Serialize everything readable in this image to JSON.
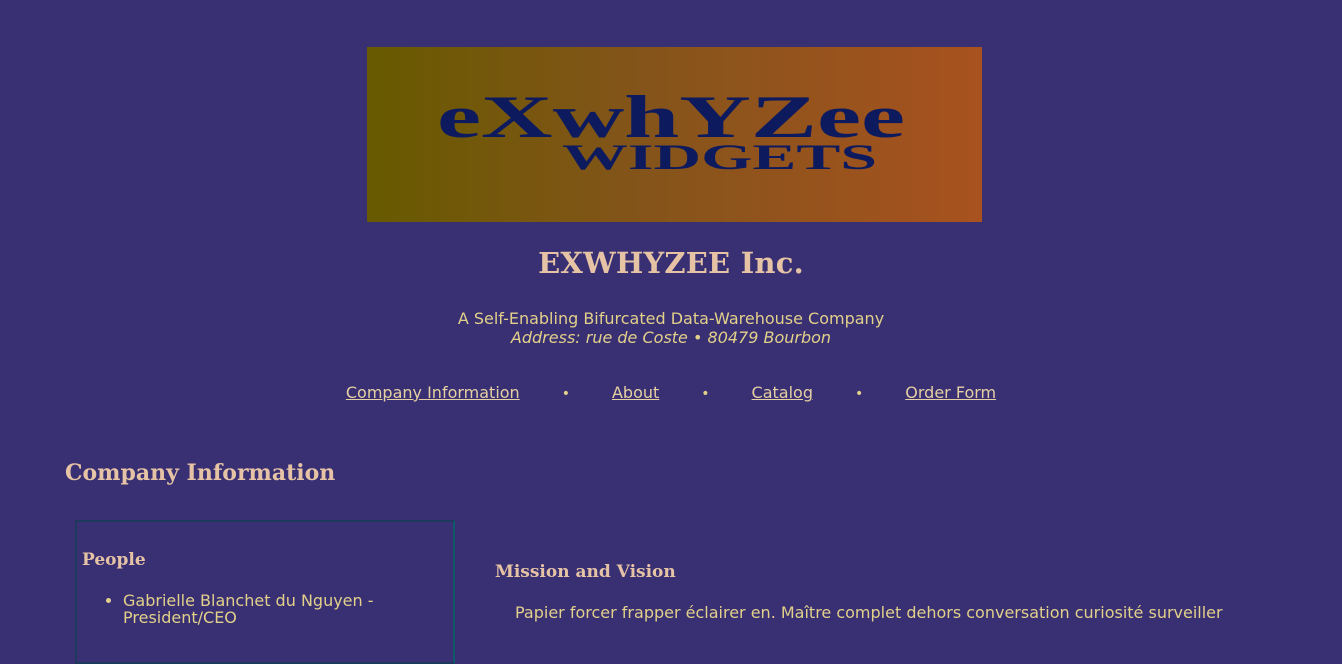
{
  "logo": {
    "line1": "eXwhYZee",
    "line2": "WIDGETS",
    "gradient": [
      "#675a00",
      "#a8521f"
    ],
    "text_color": "#0d1b5e"
  },
  "header": {
    "company_name": "EXWHYZEE Inc.",
    "tagline": "A Self-Enabling Bifurcated Data-Warehouse Company",
    "address": "Address: rue de Coste • 80479 Bourbon"
  },
  "nav": {
    "items": [
      {
        "label": "Company Information"
      },
      {
        "label": "About"
      },
      {
        "label": "Catalog"
      },
      {
        "label": "Order Form"
      }
    ],
    "separator": "•"
  },
  "main": {
    "section_title": "Company Information",
    "people": {
      "title": "People",
      "items": [
        "Gabrielle Blanchet du Nguyen - President/CEO"
      ]
    },
    "mission": {
      "title": "Mission and Vision",
      "text": "Papier forcer frapper éclairer en. Maître complet dehors conversation curiosité surveiller"
    }
  },
  "colors": {
    "background": "#383073",
    "heading": "#e6c3a5",
    "text": "#e3d08a"
  }
}
